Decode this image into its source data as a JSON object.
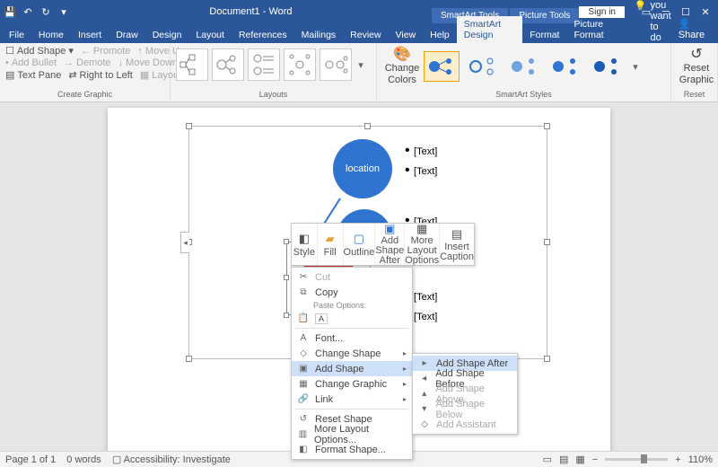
{
  "titlebar": {
    "doc_title": "Document1 - Word",
    "tool_tabs": [
      "SmartArt Tools",
      "Picture Tools"
    ],
    "signin": "Sign in"
  },
  "tabs": {
    "items": [
      "File",
      "Home",
      "Insert",
      "Draw",
      "Design",
      "Layout",
      "References",
      "Mailings",
      "Review",
      "View",
      "Help",
      "SmartArt Design",
      "Format",
      "Picture Format"
    ],
    "active": 11,
    "tellme": "Tell me what you want to do",
    "share": "Share"
  },
  "ribbon": {
    "create_graphic": {
      "label": "Create Graphic",
      "add_shape": "Add Shape",
      "add_bullet": "Add Bullet",
      "text_pane": "Text Pane",
      "promote": "Promote",
      "demote": "Demote",
      "right_to_left": "Right to Left",
      "move_up": "Move Up",
      "move_down": "Move Down",
      "layout": "Layout"
    },
    "layouts": {
      "label": "Layouts"
    },
    "change_colors": {
      "line1": "Change",
      "line2": "Colors"
    },
    "styles": {
      "label": "SmartArt Styles"
    },
    "reset": {
      "label": "Reset",
      "line1": "Reset",
      "line2": "Graphic"
    }
  },
  "smartart": {
    "node1": "location",
    "placeholders": [
      "[Text]",
      "[Text]",
      "[Text]",
      "[Text]",
      "[Text]"
    ]
  },
  "minitoolbar": {
    "items": [
      "Style",
      "Fill",
      "Outline",
      "Add Shape After",
      "More Layout Options",
      "Insert Caption"
    ]
  },
  "contextmenu": {
    "cut": "Cut",
    "copy": "Copy",
    "paste_options": "Paste Options:",
    "font": "Font...",
    "change_shape": "Change Shape",
    "add_shape": "Add Shape",
    "change_graphic": "Change Graphic",
    "link": "Link",
    "reset_shape": "Reset Shape",
    "more_layout": "More Layout Options...",
    "format_shape": "Format Shape..."
  },
  "submenu": {
    "after": "Add Shape After",
    "before": "Add Shape Before",
    "above": "Add Shape Above",
    "below": "Add Shape Below",
    "assistant": "Add Assistant"
  },
  "statusbar": {
    "page": "Page 1 of 1",
    "words": "0 words",
    "accessibility": "Accessibility: Investigate",
    "zoom": "110%"
  }
}
